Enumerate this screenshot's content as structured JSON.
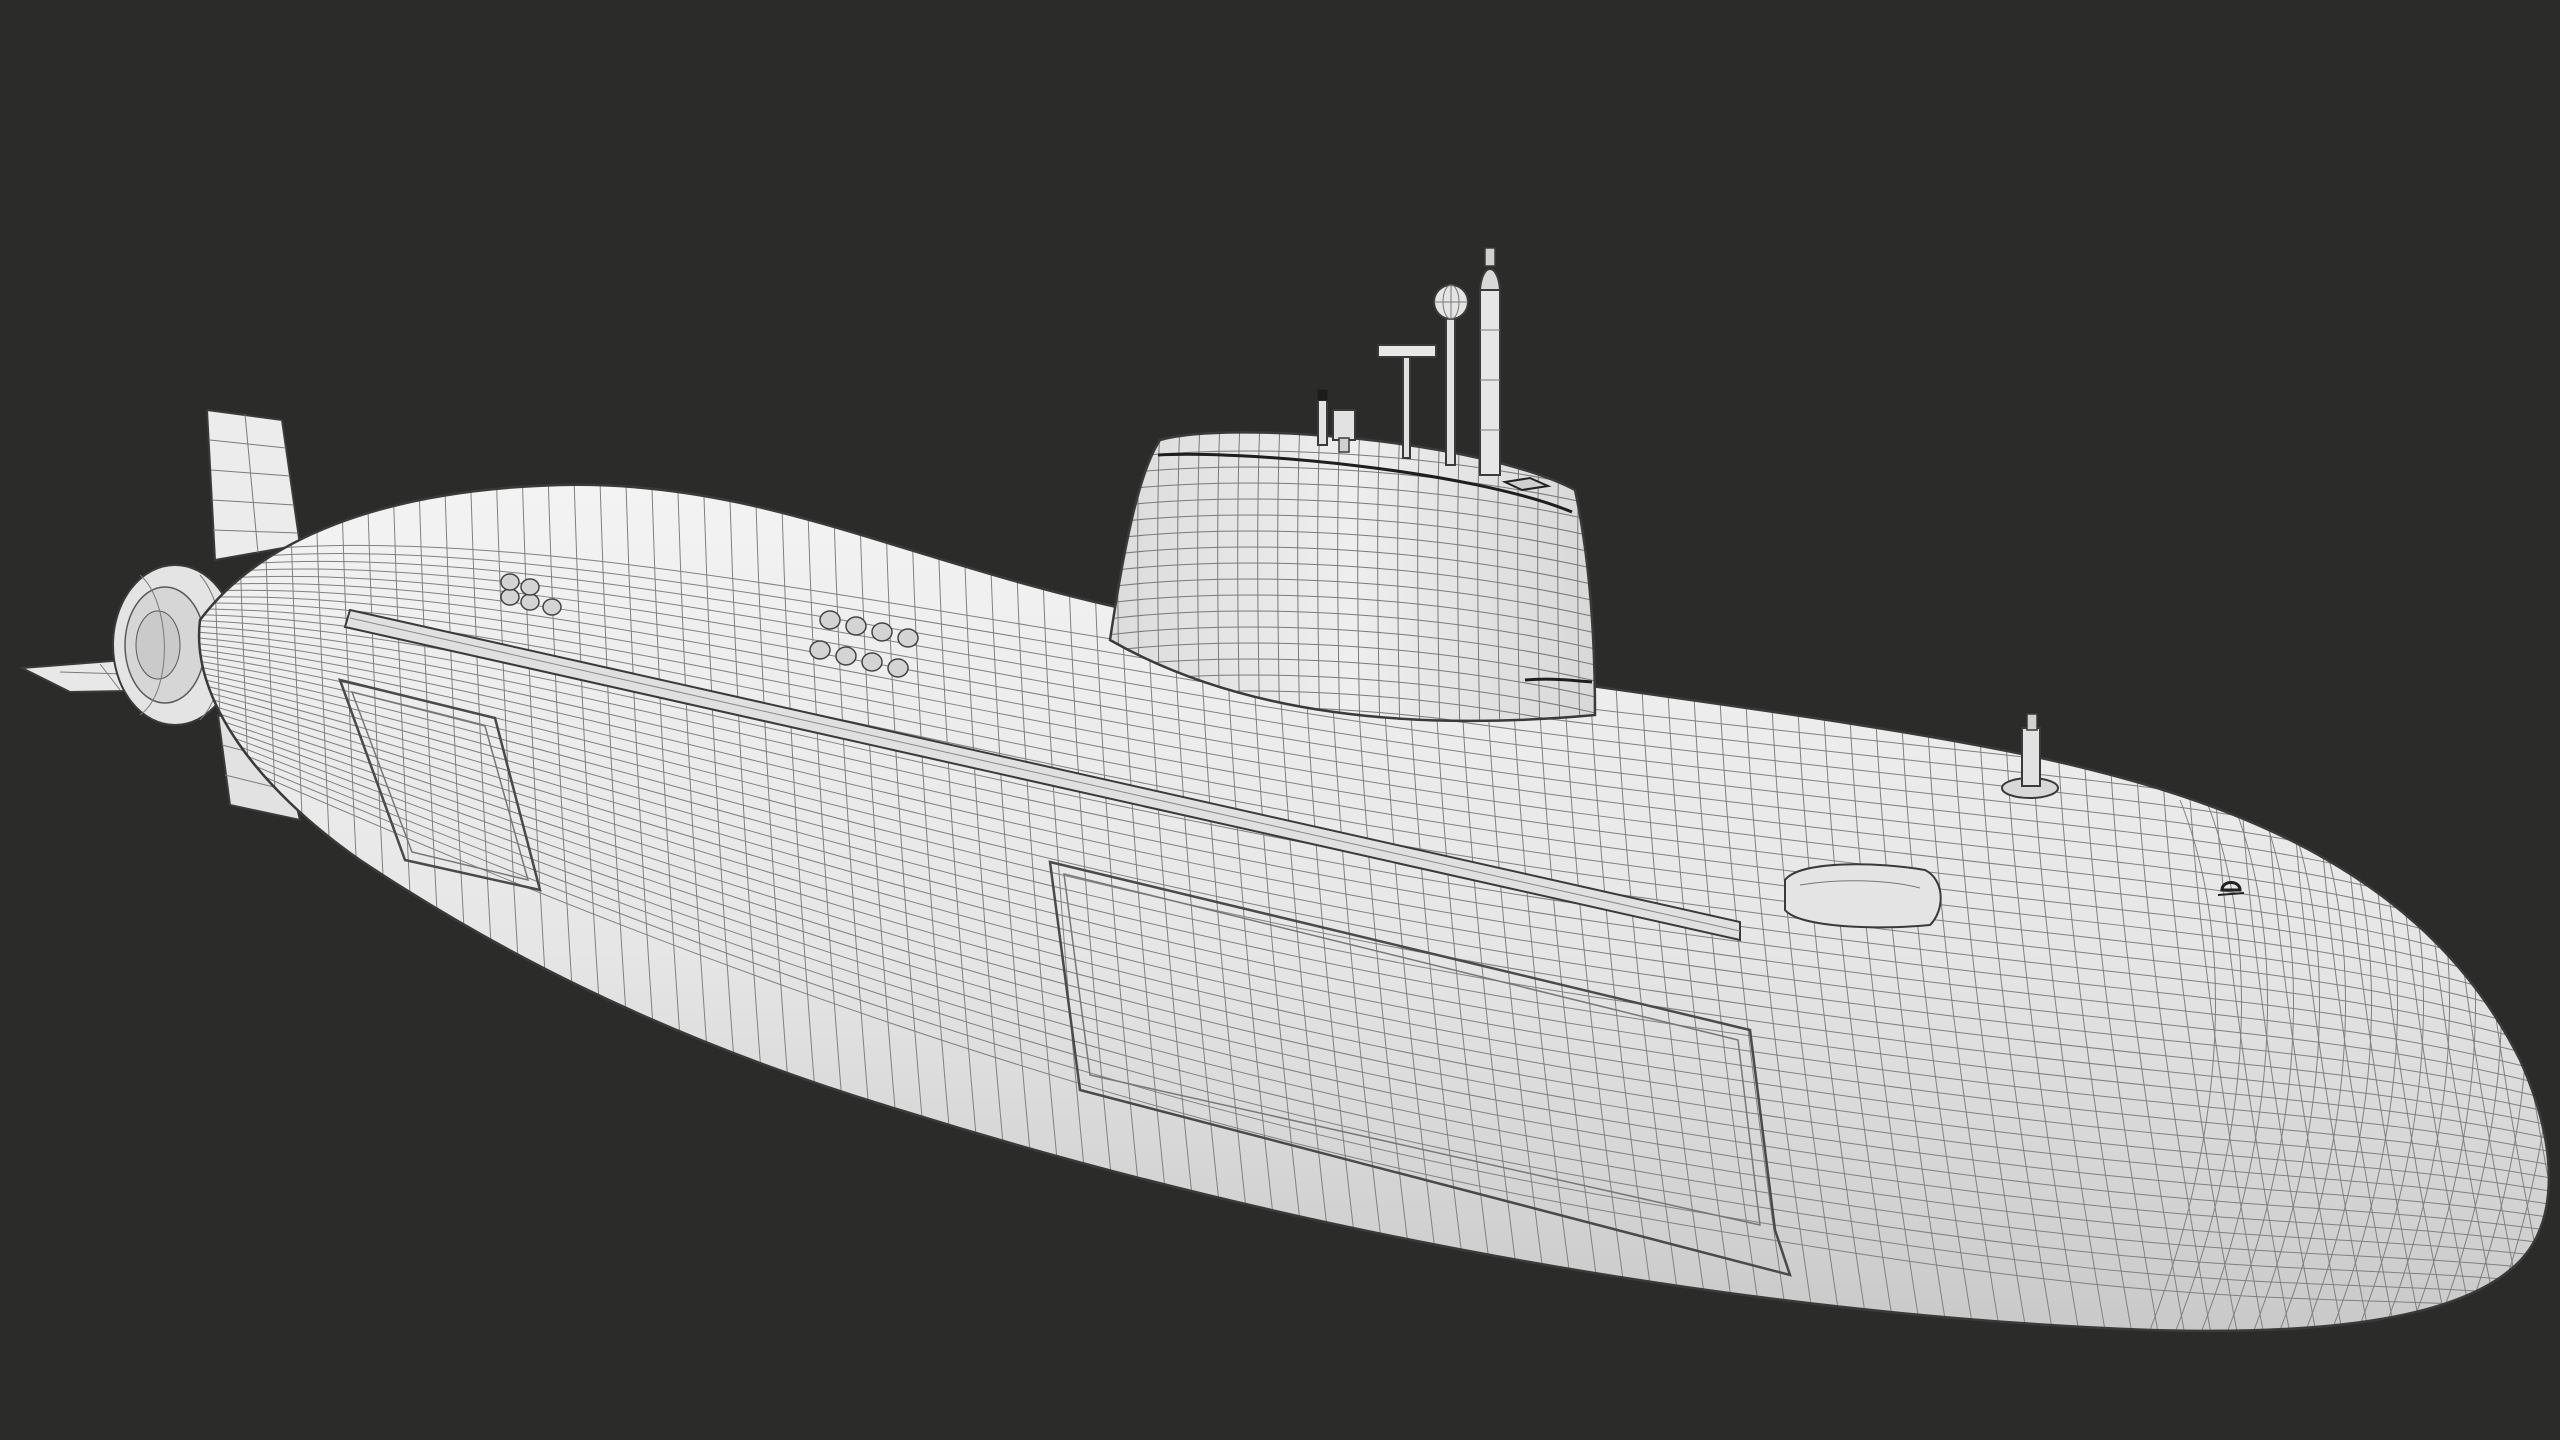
{
  "scene": {
    "subject": "submarine-wireframe-model",
    "render_style": "clay-wireframe",
    "colors": {
      "background": "#2b2b2a",
      "surface": "#e9e9e9",
      "surface_shade": "#cfcfcf",
      "wire": "#6a6a6a",
      "outline": "#3a3a3a",
      "dark_detail": "#1c1c1c"
    }
  }
}
